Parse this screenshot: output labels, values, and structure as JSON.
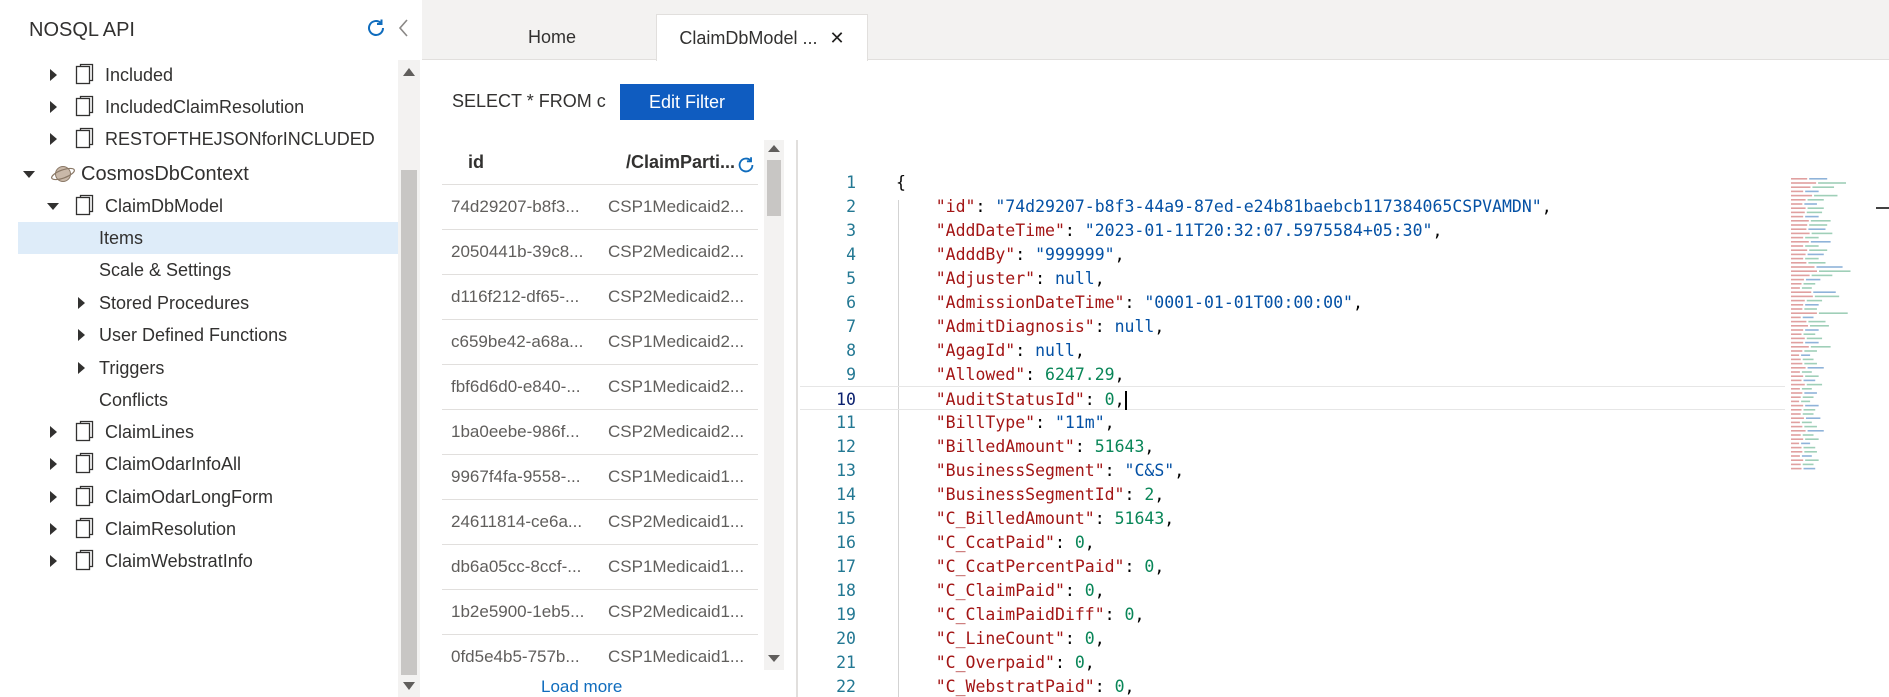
{
  "sidebar": {
    "title": "NOSQL API",
    "tree": [
      {
        "label": "Included",
        "level": 2,
        "type": "container",
        "expanded": false
      },
      {
        "label": "IncludedClaimResolution",
        "level": 2,
        "type": "container",
        "expanded": false
      },
      {
        "label": "RESTOFTHEJSONforINCLUDED",
        "level": 2,
        "type": "container",
        "expanded": false
      },
      {
        "label": "CosmosDbContext",
        "level": 1,
        "type": "database",
        "expanded": true
      },
      {
        "label": "ClaimDbModel",
        "level": 2,
        "type": "container",
        "expanded": true
      },
      {
        "label": "Items",
        "level": 3,
        "type": "node",
        "selected": true
      },
      {
        "label": "Scale & Settings",
        "level": 3,
        "type": "node"
      },
      {
        "label": "Stored Procedures",
        "level": 3,
        "type": "group",
        "expanded": false
      },
      {
        "label": "User Defined Functions",
        "level": 3,
        "type": "group",
        "expanded": false
      },
      {
        "label": "Triggers",
        "level": 3,
        "type": "group",
        "expanded": false
      },
      {
        "label": "Conflicts",
        "level": 3,
        "type": "node"
      },
      {
        "label": "ClaimLines",
        "level": 2,
        "type": "container",
        "expanded": false
      },
      {
        "label": "ClaimOdarInfoAll",
        "level": 2,
        "type": "container",
        "expanded": false
      },
      {
        "label": "ClaimOdarLongForm",
        "level": 2,
        "type": "container",
        "expanded": false
      },
      {
        "label": "ClaimResolution",
        "level": 2,
        "type": "container",
        "expanded": false
      },
      {
        "label": "ClaimWebstratInfo",
        "level": 2,
        "type": "container",
        "expanded": false
      }
    ]
  },
  "tabs": [
    {
      "label": "Home",
      "active": false
    },
    {
      "label": "ClaimDbModel ...",
      "active": true,
      "close": "✕"
    }
  ],
  "filter": {
    "query": "SELECT * FROM c",
    "button_label": "Edit Filter"
  },
  "grid": {
    "columns": [
      "id",
      "/ClaimParti..."
    ],
    "rows": [
      [
        "74d29207-b8f3...",
        "CSP1Medicaid2..."
      ],
      [
        "2050441b-39c8...",
        "CSP2Medicaid2..."
      ],
      [
        "d116f212-df65-...",
        "CSP2Medicaid2..."
      ],
      [
        "c659be42-a68a...",
        "CSP1Medicaid2..."
      ],
      [
        "fbf6d6d0-e840-...",
        "CSP1Medicaid2..."
      ],
      [
        "1ba0eebe-986f...",
        "CSP2Medicaid2..."
      ],
      [
        "9967f4fa-9558-...",
        "CSP1Medicaid1..."
      ],
      [
        "24611814-ce6a...",
        "CSP2Medicaid1..."
      ],
      [
        "db6a05cc-8ccf-...",
        "CSP1Medicaid1..."
      ],
      [
        "1b2e5900-1eb5...",
        "CSP2Medicaid1..."
      ],
      [
        "0fd5e4b5-757b...",
        "CSP1Medicaid1..."
      ]
    ],
    "load_more": "Load more"
  },
  "editor": {
    "current_line": 10,
    "lines": [
      {
        "n": "1",
        "tokens": [
          [
            "p",
            "{"
          ]
        ]
      },
      {
        "n": "2",
        "tokens": [
          [
            "i",
            "    "
          ],
          [
            "key",
            "\"id\""
          ],
          [
            "p",
            ": "
          ],
          [
            "str",
            "\"74d29207-b8f3-44a9-87ed-e24b81baebcb117384065CSPVAMDN\""
          ],
          [
            "p",
            ","
          ]
        ]
      },
      {
        "n": "3",
        "tokens": [
          [
            "i",
            "    "
          ],
          [
            "key",
            "\"AddDateTime\""
          ],
          [
            "p",
            ": "
          ],
          [
            "str",
            "\"2023-01-11T20:32:07.5975584+05:30\""
          ],
          [
            "p",
            ","
          ]
        ]
      },
      {
        "n": "4",
        "tokens": [
          [
            "i",
            "    "
          ],
          [
            "key",
            "\"AdddBy\""
          ],
          [
            "p",
            ": "
          ],
          [
            "str",
            "\"999999\""
          ],
          [
            "p",
            ","
          ]
        ]
      },
      {
        "n": "5",
        "tokens": [
          [
            "i",
            "    "
          ],
          [
            "key",
            "\"Adjuster\""
          ],
          [
            "p",
            ": "
          ],
          [
            "kw",
            "null"
          ],
          [
            "p",
            ","
          ]
        ]
      },
      {
        "n": "6",
        "tokens": [
          [
            "i",
            "    "
          ],
          [
            "key",
            "\"AdmissionDateTime\""
          ],
          [
            "p",
            ": "
          ],
          [
            "str",
            "\"0001-01-01T00:00:00\""
          ],
          [
            "p",
            ","
          ]
        ]
      },
      {
        "n": "7",
        "tokens": [
          [
            "i",
            "    "
          ],
          [
            "key",
            "\"AdmitDiagnosis\""
          ],
          [
            "p",
            ": "
          ],
          [
            "kw",
            "null"
          ],
          [
            "p",
            ","
          ]
        ]
      },
      {
        "n": "8",
        "tokens": [
          [
            "i",
            "    "
          ],
          [
            "key",
            "\"AgagId\""
          ],
          [
            "p",
            ": "
          ],
          [
            "kw",
            "null"
          ],
          [
            "p",
            ","
          ]
        ]
      },
      {
        "n": "9",
        "tokens": [
          [
            "i",
            "    "
          ],
          [
            "key",
            "\"Allowed\""
          ],
          [
            "p",
            ": "
          ],
          [
            "num",
            "6247.29"
          ],
          [
            "p",
            ","
          ]
        ]
      },
      {
        "n": "10",
        "tokens": [
          [
            "i",
            "    "
          ],
          [
            "key",
            "\"AuditStatusId\""
          ],
          [
            "p",
            ": "
          ],
          [
            "num",
            "0"
          ],
          [
            "p",
            ","
          ],
          [
            "cursor",
            ""
          ]
        ]
      },
      {
        "n": "11",
        "tokens": [
          [
            "i",
            "    "
          ],
          [
            "key",
            "\"BillType\""
          ],
          [
            "p",
            ": "
          ],
          [
            "str",
            "\"11m\""
          ],
          [
            "p",
            ","
          ]
        ]
      },
      {
        "n": "12",
        "tokens": [
          [
            "i",
            "    "
          ],
          [
            "key",
            "\"BilledAmount\""
          ],
          [
            "p",
            ": "
          ],
          [
            "num",
            "51643"
          ],
          [
            "p",
            ","
          ]
        ]
      },
      {
        "n": "13",
        "tokens": [
          [
            "i",
            "    "
          ],
          [
            "key",
            "\"BusinessSegment\""
          ],
          [
            "p",
            ": "
          ],
          [
            "str",
            "\"C&S\""
          ],
          [
            "p",
            ","
          ]
        ]
      },
      {
        "n": "14",
        "tokens": [
          [
            "i",
            "    "
          ],
          [
            "key",
            "\"BusinessSegmentId\""
          ],
          [
            "p",
            ": "
          ],
          [
            "num",
            "2"
          ],
          [
            "p",
            ","
          ]
        ]
      },
      {
        "n": "15",
        "tokens": [
          [
            "i",
            "    "
          ],
          [
            "key",
            "\"C_BilledAmount\""
          ],
          [
            "p",
            ": "
          ],
          [
            "num",
            "51643"
          ],
          [
            "p",
            ","
          ]
        ]
      },
      {
        "n": "16",
        "tokens": [
          [
            "i",
            "    "
          ],
          [
            "key",
            "\"C_CcatPaid\""
          ],
          [
            "p",
            ": "
          ],
          [
            "num",
            "0"
          ],
          [
            "p",
            ","
          ]
        ]
      },
      {
        "n": "17",
        "tokens": [
          [
            "i",
            "    "
          ],
          [
            "key",
            "\"C_CcatPercentPaid\""
          ],
          [
            "p",
            ": "
          ],
          [
            "num",
            "0"
          ],
          [
            "p",
            ","
          ]
        ]
      },
      {
        "n": "18",
        "tokens": [
          [
            "i",
            "    "
          ],
          [
            "key",
            "\"C_ClaimPaid\""
          ],
          [
            "p",
            ": "
          ],
          [
            "num",
            "0"
          ],
          [
            "p",
            ","
          ]
        ]
      },
      {
        "n": "19",
        "tokens": [
          [
            "i",
            "    "
          ],
          [
            "key",
            "\"C_ClaimPaidDiff\""
          ],
          [
            "p",
            ": "
          ],
          [
            "num",
            "0"
          ],
          [
            "p",
            ","
          ]
        ]
      },
      {
        "n": "20",
        "tokens": [
          [
            "i",
            "    "
          ],
          [
            "key",
            "\"C_LineCount\""
          ],
          [
            "p",
            ": "
          ],
          [
            "num",
            "0"
          ],
          [
            "p",
            ","
          ]
        ]
      },
      {
        "n": "21",
        "tokens": [
          [
            "i",
            "    "
          ],
          [
            "key",
            "\"C_Overpaid\""
          ],
          [
            "p",
            ": "
          ],
          [
            "num",
            "0"
          ],
          [
            "p",
            ","
          ]
        ]
      },
      {
        "n": "22",
        "tokens": [
          [
            "i",
            "    "
          ],
          [
            "key",
            "\"C_WebstratPaid\""
          ],
          [
            "p",
            ": "
          ],
          [
            "num",
            "0"
          ],
          [
            "p",
            ","
          ]
        ]
      }
    ]
  },
  "colors": {
    "accent": "#0f5cc0",
    "selected_bg": "#deecf9",
    "link": "#0f6cbd",
    "json_key": "#a31515",
    "json_string": "#0451a5",
    "json_number": "#098658",
    "line_number": "#237893"
  },
  "icons": {
    "refresh": "refresh-icon",
    "collapse": "chevron-left-icon",
    "container": "document-icon",
    "database": "planet-icon",
    "expand": "caret-right-icon",
    "collapse_node": "caret-down-icon",
    "close": "close-icon"
  }
}
